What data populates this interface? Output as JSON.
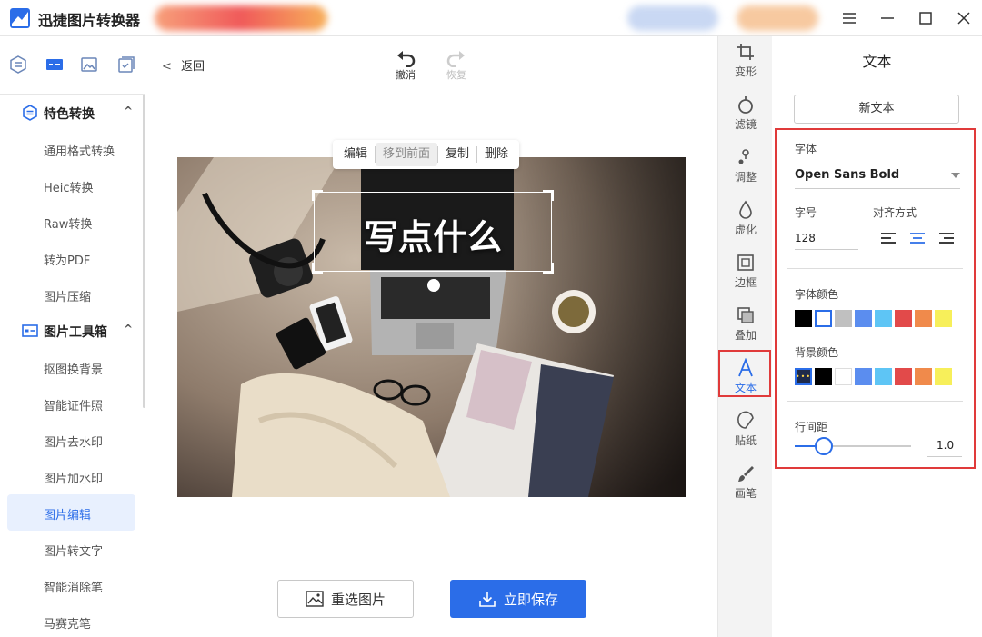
{
  "app": {
    "title": "迅捷图片转换器"
  },
  "sidebar": {
    "groups": [
      {
        "label": "特色转换",
        "chevron": "^",
        "items": [
          "通用格式转换",
          "Heic转换",
          "Raw转换",
          "转为PDF",
          "图片压缩"
        ]
      },
      {
        "label": "图片工具箱",
        "chevron": "^",
        "items": [
          "抠图换背景",
          "智能证件照",
          "图片去水印",
          "图片加水印",
          "图片编辑",
          "图片转文字",
          "智能消除笔",
          "马赛克笔"
        ]
      }
    ],
    "active_item": "图片编辑"
  },
  "main": {
    "back_label": "返回",
    "back_icon": "chevron-left-icon",
    "undo_label": "撤消",
    "redo_label": "恢复",
    "float_toolbar": {
      "edit": "编辑",
      "bring_front": "移到前面",
      "copy": "复制",
      "delete": "删除"
    },
    "canvas_text": "写点什么",
    "reselect_label": "重选图片",
    "save_label": "立即保存"
  },
  "tools": [
    {
      "label": "变形",
      "icon": "crop-icon"
    },
    {
      "label": "滤镜",
      "icon": "filter-icon"
    },
    {
      "label": "调整",
      "icon": "adjust-icon"
    },
    {
      "label": "虚化",
      "icon": "blur-icon"
    },
    {
      "label": "边框",
      "icon": "border-icon"
    },
    {
      "label": "叠加",
      "icon": "overlay-icon"
    },
    {
      "label": "文本",
      "icon": "text-icon"
    },
    {
      "label": "贴纸",
      "icon": "sticker-icon"
    },
    {
      "label": "画笔",
      "icon": "brush-icon"
    }
  ],
  "panel": {
    "title": "文本",
    "new_text_label": "新文本",
    "font_label": "字体",
    "font_value": "Open Sans Bold",
    "size_label": "字号",
    "size_value": "128",
    "align_label": "对齐方式",
    "font_color_label": "字体颜色",
    "bg_color_label": "背景颜色",
    "line_spacing_label": "行间距",
    "line_spacing_value": "1.0",
    "font_colors": [
      "#000000",
      "#ffffff",
      "#c0c0c0",
      "#5b8def",
      "#5ec5f5",
      "#e24a4a",
      "#f08a4b",
      "#f7ef5a"
    ],
    "bg_colors": [
      "#000000",
      "#ffffff",
      "#5b8def",
      "#5ec5f5",
      "#e24a4a",
      "#f08a4b",
      "#f7ef5a"
    ]
  },
  "colors": {
    "accent": "#2b6de8",
    "highlight": "#e03a3a"
  }
}
